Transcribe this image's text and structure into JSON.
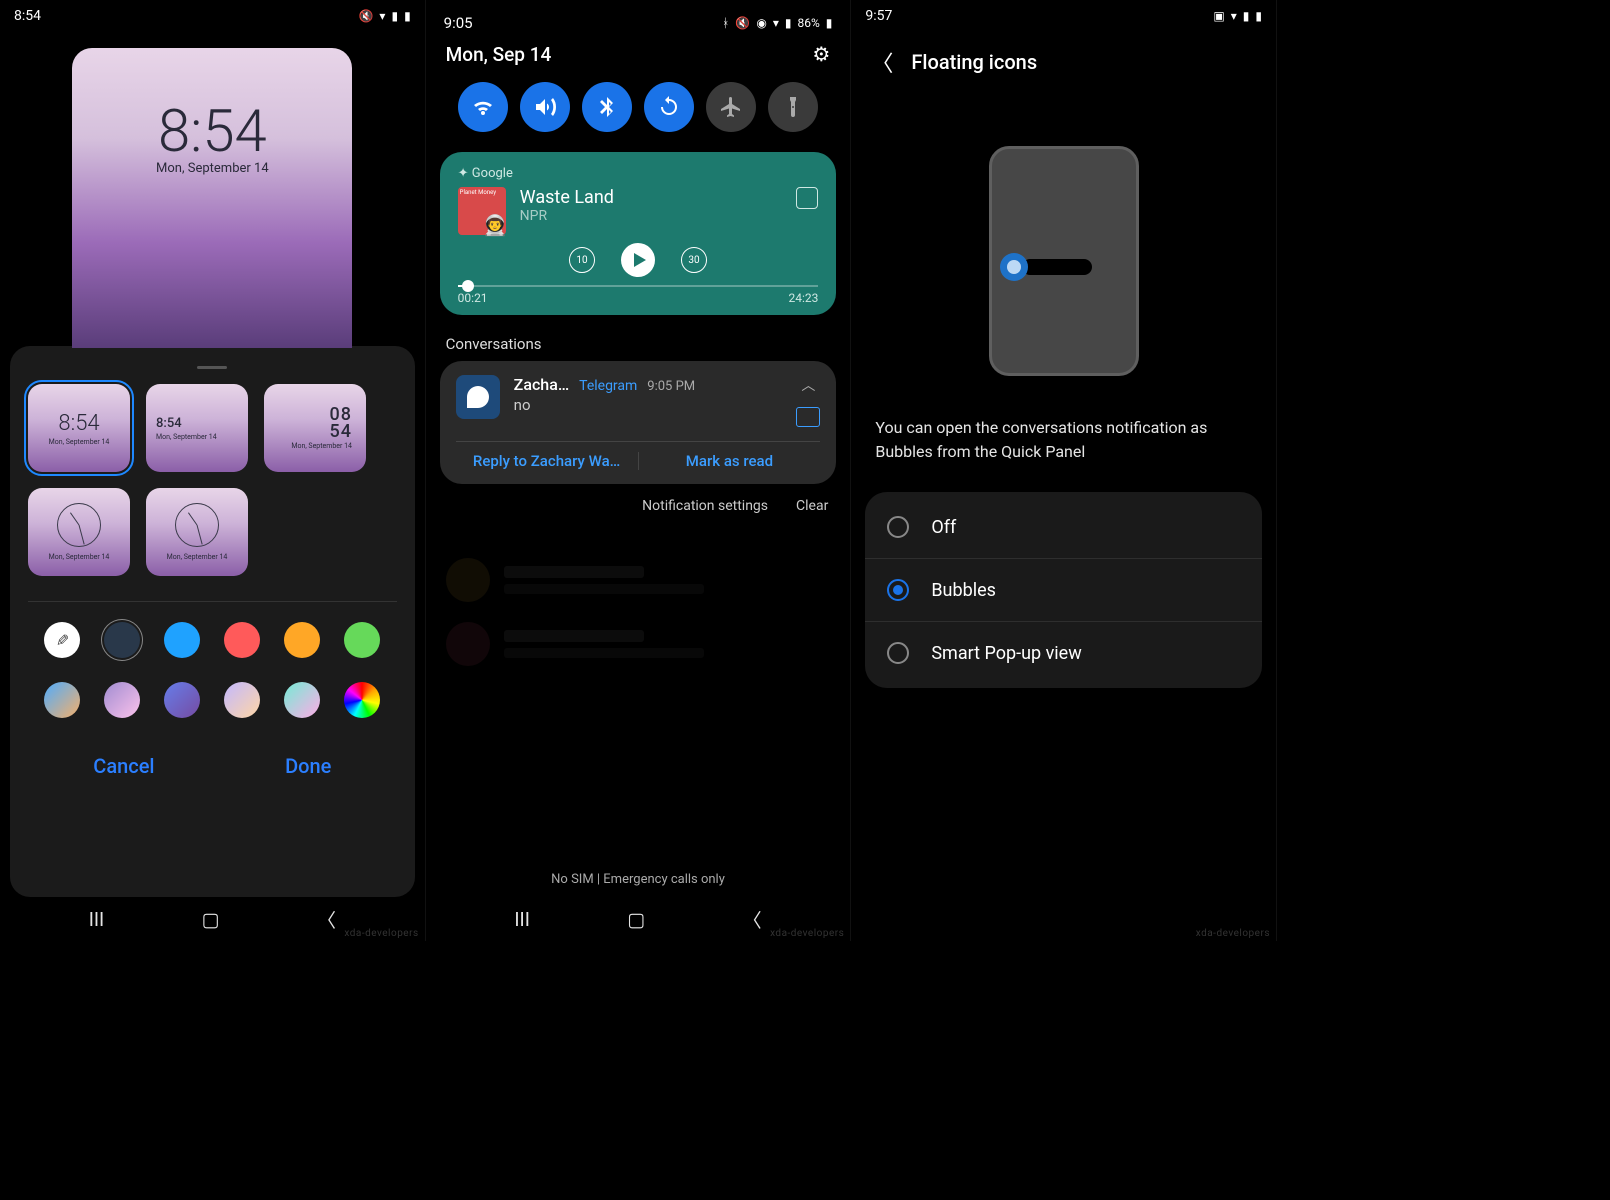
{
  "screen1": {
    "status_time": "8:54",
    "preview_time": "8:54",
    "preview_date": "Mon, September 14",
    "clock_options": {
      "opt1": {
        "time": "8:54",
        "date": "Mon, September 14"
      },
      "opt2": {
        "time": "8:54",
        "date": "Mon, September 14"
      },
      "opt3": {
        "hour": "08",
        "min": "54",
        "date": "Mon, September 14"
      },
      "opt4": {
        "date": "Mon, September 14"
      },
      "opt5": {
        "date": "Mon, September 14"
      }
    },
    "cancel": "Cancel",
    "done": "Done"
  },
  "screen2": {
    "status_time": "9:05",
    "status_battery": "86%",
    "date": "Mon, Sep 14",
    "media": {
      "source": "Google",
      "art_label": "Planet Money",
      "title": "Waste Land",
      "subtitle": "NPR",
      "rewind": "10",
      "forward": "30",
      "elapsed": "00:21",
      "total": "24:23"
    },
    "conversations_header": "Conversations",
    "conversation": {
      "name": "Zacha…",
      "app": "Telegram",
      "time": "9:05 PM",
      "message": "no",
      "reply": "Reply to Zachary Wa…",
      "mark_read": "Mark as read"
    },
    "notification_settings": "Notification settings",
    "clear": "Clear",
    "footer": "No SIM | Emergency calls only"
  },
  "screen3": {
    "status_time": "9:57",
    "title": "Floating icons",
    "description": "You can open the conversations notification as Bubbles from the Quick Panel",
    "options": {
      "off": "Off",
      "bubbles": "Bubbles",
      "smart": "Smart Pop-up view"
    }
  },
  "watermark": "xda-developers"
}
